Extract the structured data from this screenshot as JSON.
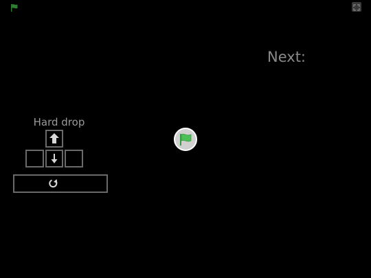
{
  "stage": {
    "next_label": "Next:",
    "hint_label": "Hard drop"
  },
  "controls": {
    "up_key_icon": "arrow-up-icon",
    "down_key_icon": "arrow-down-icon",
    "rotate_key_icon": "rotate-icon"
  },
  "colors": {
    "background": "#000000",
    "flag_green": "#4cbf56",
    "label_gray": "#8a8a8a",
    "key_border": "#6a6a6a"
  }
}
